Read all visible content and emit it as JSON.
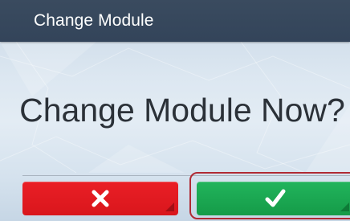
{
  "dialog": {
    "title": "Change Module",
    "prompt": "Change Module Now?"
  },
  "buttons": {
    "cancel": {
      "icon": "x-icon",
      "color": "#e01a21"
    },
    "confirm": {
      "icon": "checkmark-icon",
      "color": "#1aa852"
    }
  },
  "colors": {
    "title_bar": "#364759",
    "prompt_text": "#2b3138",
    "highlight": "#b02a34"
  }
}
